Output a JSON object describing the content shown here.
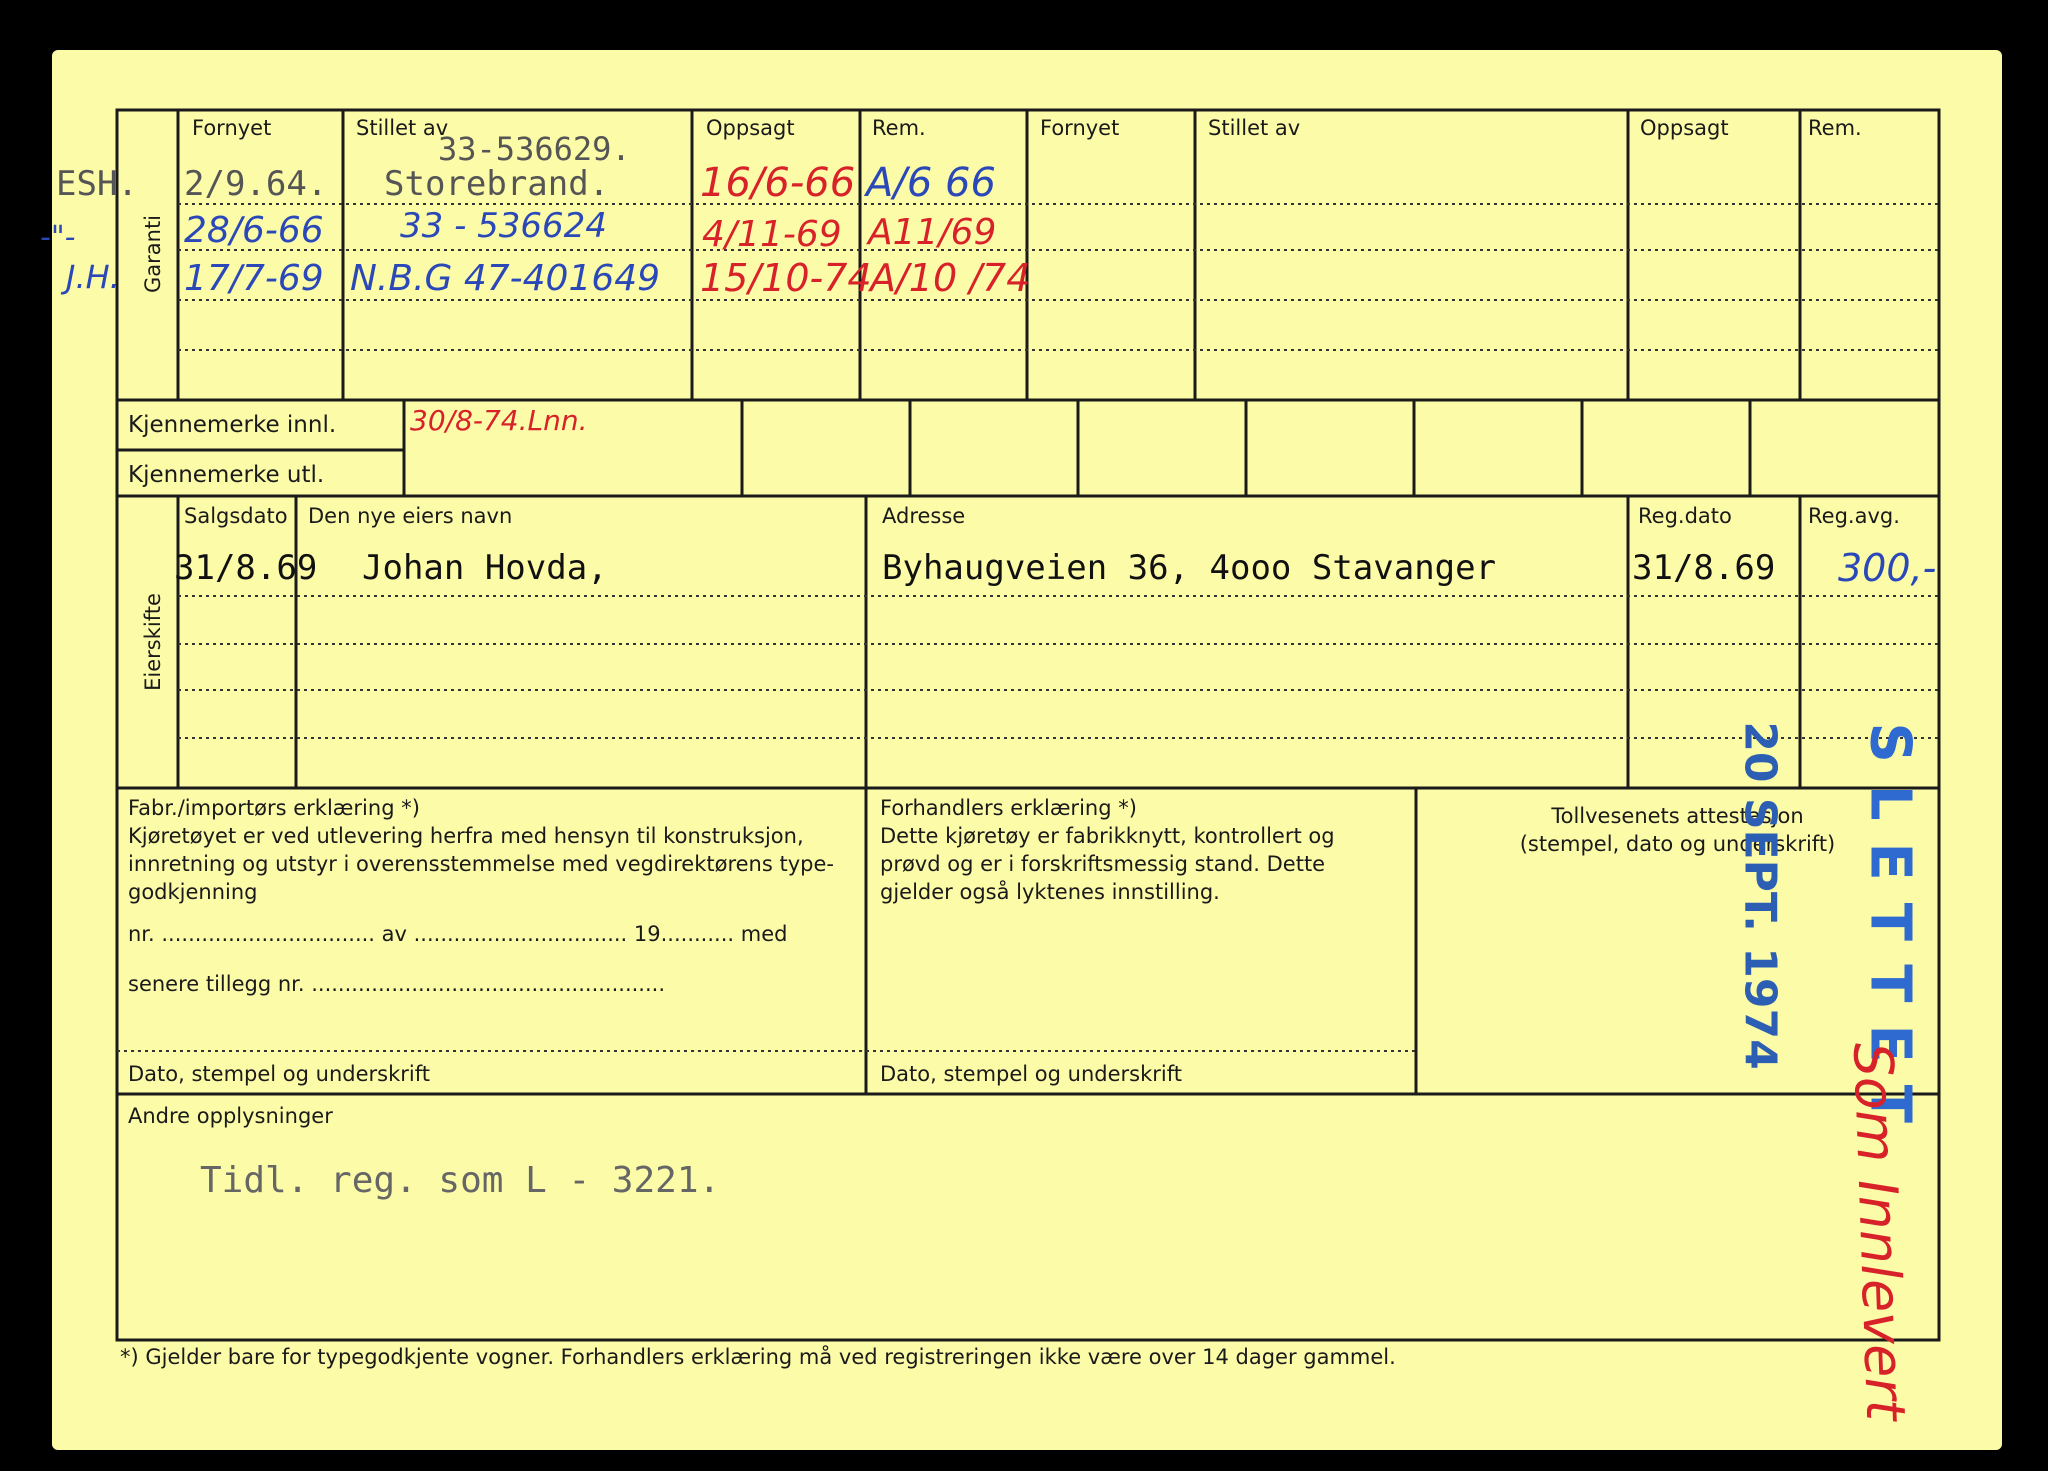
{
  "top_section": {
    "side_label": "Garanti",
    "headers": [
      "Fornyet",
      "Stillet av",
      "Oppsagt",
      "Rem.",
      "Fornyet",
      "Stillet av",
      "Oppsagt",
      "Rem."
    ],
    "row1": {
      "prefix": "ESH.",
      "fornyet": "2/9.64.",
      "policy": "33-536629.",
      "stillet_av": "Storebrand.",
      "oppsagt": "16/6-66",
      "rem": "A/6 66"
    },
    "row2": {
      "prefix": "-\"-",
      "fornyet": "28/6-66",
      "stillet_av": "33 - 536624",
      "oppsagt": "4/11-69",
      "rem": "A11/69"
    },
    "row3": {
      "prefix": "J.H.",
      "fornyet": "17/7-69",
      "stillet_av": "N.B.G 47-401649",
      "oppsagt": "15/10-74",
      "rem": "A/10 /74"
    }
  },
  "kjennemerke": {
    "innl_label": "Kjennemerke innl.",
    "utl_label": "Kjennemerke utl.",
    "innl_note": "30/8-74.Lnn."
  },
  "eierskifte": {
    "side_label": "Eierskifte",
    "headers": {
      "salgsdato": "Salgsdato",
      "navn": "Den nye eiers navn",
      "adresse": "Adresse",
      "regdato": "Reg.dato",
      "regavg": "Reg.avg."
    },
    "row1": {
      "salgsdato": "31/8.69",
      "navn": "Johan Hovda,",
      "adresse": "Byhaugveien 36, 4ooo Stavanger",
      "regdato": "31/8.69",
      "regavg": "300,-"
    }
  },
  "declarations": {
    "fabr_title": "Fabr./importørs erklæring *)",
    "fabr_text": "Kjøretøyet er ved utlevering herfra med hensyn til konstruksjon,\ninnretning og utstyr i overensstemmelse med vegdirektørens type-\ngodkjenning",
    "fabr_line1": "nr. ................................ av ................................ 19........... med",
    "fabr_line2": "senere tillegg nr. .....................................................",
    "fabr_sign": "Dato, stempel og underskrift",
    "forh_title": "Forhandlers erklæring *)",
    "forh_text": "Dette kjøretøy er fabrikknytt, kontrollert og\nprøvd og er i forskriftsmessig stand. Dette\ngjelder også lyktenes innstilling.",
    "forh_sign": "Dato, stempel og underskrift",
    "toll_title": "Tollvesenets attestasjon",
    "toll_sub": "(stempel, dato og underskrift)"
  },
  "andre": {
    "label": "Andre opplysninger",
    "text": "Tidl. reg. som L - 3221."
  },
  "stamps": {
    "slettet": "SLETTET",
    "date": "20 SEPT. 1974",
    "handwritten": "Som Innlevert"
  },
  "footnote": "*)   Gjelder bare for typegodkjente vogner.  Forhandlers erklæring må ved registreringen ikke være over 14 dager gammel."
}
